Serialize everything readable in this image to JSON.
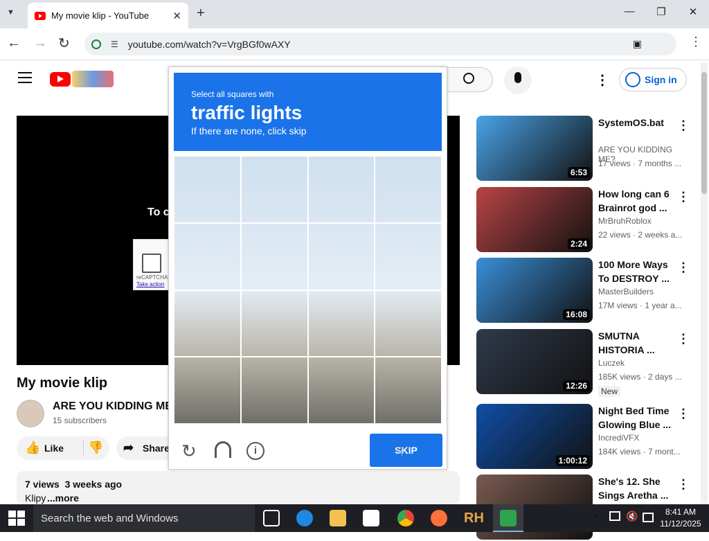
{
  "browser": {
    "tab_title": "My movie klip - YouTube",
    "url": "youtube.com/watch?v=VrgBGf0wAXY"
  },
  "youtube": {
    "sign_in": "Sign in",
    "video_title": "My movie klip",
    "channel_name": "ARE YOU KIDDING ME?",
    "subscribers": "15 subscribers",
    "like_label": "Like",
    "share_label": "Share",
    "description_meta": "7 views  3 weeks ago",
    "description_text": "Klipy",
    "more_label": "...more",
    "player_partial_text": "To c",
    "recaptcha_partial": "reCAPTCHA",
    "take_action_partial": "Take action"
  },
  "sidebar": {
    "items": [
      {
        "title": "SystemOS.bat",
        "channel": "ARE YOU KIDDING ME?",
        "meta": "17 views · 7 months ...",
        "duration": "6:53",
        "color": "#4aa3e8"
      },
      {
        "title": "How long can 6 Brainrot god ...",
        "channel": "MrBruhRoblox",
        "meta": "22 views · 2 weeks a...",
        "duration": "2:24",
        "color": "#b94444"
      },
      {
        "title": "100 More Ways To DESTROY ...",
        "channel": "MasterBuilders",
        "meta": "17M views · 1 year a...",
        "duration": "16:08",
        "color": "#3a8fd8"
      },
      {
        "title": "SMUTNA HISTORIA ...",
        "channel": "Luczek",
        "meta": "185K views · 2 days ...",
        "badge": "New",
        "duration": "12:26",
        "color": "#2f3a4a"
      },
      {
        "title": "Night Bed Time Glowing Blue ...",
        "channel": "IncrediVFX",
        "meta": "184K views · 7 mont...",
        "duration": "1:00:12",
        "color": "#0f4fa8"
      },
      {
        "title": "She's 12. She Sings Aretha ...",
        "channel": "",
        "meta": "",
        "duration": "",
        "color": "#7a5a50"
      }
    ]
  },
  "captcha": {
    "instruction": "Select all squares with",
    "target": "traffic lights",
    "hint": "If there are none, click skip",
    "skip_label": "SKIP"
  },
  "taskbar": {
    "search_placeholder": "Search the web and Windows",
    "time": "8:41 AM",
    "date": "11/12/2025"
  }
}
